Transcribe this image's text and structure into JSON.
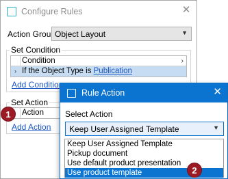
{
  "configure_rules": {
    "title": "Configure Rules",
    "action_group_label": "Action Group",
    "action_group_value": "Object Layout",
    "set_condition": {
      "title": "Set Condition",
      "header": "Condition",
      "row_prefix": "If the Object Type is ",
      "row_link": "Publication",
      "add_link": "Add Condition"
    },
    "set_action": {
      "title": "Set Action",
      "header": "Action",
      "add_link": "Add Action"
    }
  },
  "rule_action": {
    "title": "Rule Action",
    "select_label": "Select Action",
    "selected_value": "Keep User Assigned Template",
    "options": [
      "Keep User Assigned Template",
      "Pickup document",
      "Use default product presentation",
      "Use product template"
    ],
    "highlighted_index": 3
  },
  "badges": {
    "one": "1",
    "two": "2"
  },
  "colors": {
    "accent": "#0b74d1",
    "badge": "#9b1b24",
    "link": "#1a56c4"
  },
  "icons": {
    "close": "close-icon",
    "chevron": "chevron-down-icon",
    "row_marker": "row-arrow-icon"
  }
}
